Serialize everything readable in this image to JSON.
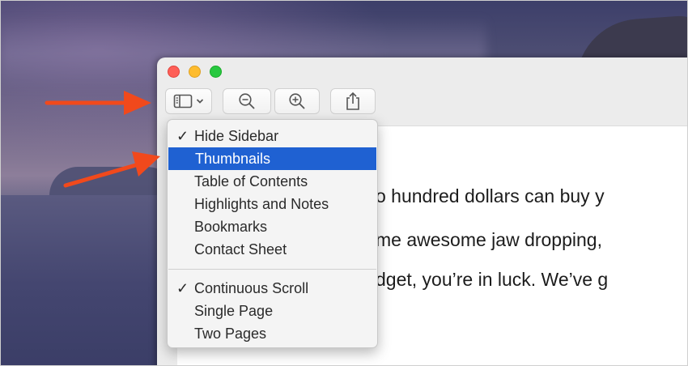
{
  "colors": {
    "menu_highlight": "#1f61d2",
    "arrow": "#f1491c",
    "close": "#fe5f57",
    "minimize": "#febc2e",
    "zoom": "#28c840"
  },
  "toolbar": {
    "sidebar_button_icon": "sidebar-icon",
    "sidebar_chevron_icon": "chevron-down-icon",
    "zoom_out_icon": "zoom-out-icon",
    "zoom_in_icon": "zoom-in-icon",
    "share_icon": "share-icon"
  },
  "menu": {
    "group1": [
      {
        "label": "Hide Sidebar",
        "checked": true,
        "selected": false
      },
      {
        "label": "Thumbnails",
        "checked": false,
        "selected": true
      },
      {
        "label": "Table of Contents",
        "checked": false,
        "selected": false
      },
      {
        "label": "Highlights and Notes",
        "checked": false,
        "selected": false
      },
      {
        "label": "Bookmarks",
        "checked": false,
        "selected": false
      },
      {
        "label": "Contact Sheet",
        "checked": false,
        "selected": false
      }
    ],
    "group2": [
      {
        "label": "Continuous Scroll",
        "checked": true,
        "selected": false
      },
      {
        "label": "Single Page",
        "checked": false,
        "selected": false
      },
      {
        "label": "Two Pages",
        "checked": false,
        "selected": false
      }
    ],
    "check_mark": "✓"
  },
  "document": {
    "lines": [
      "o hundred dollars can buy y",
      "me awesome jaw dropping,",
      "dget, you’re in luck. We’ve g"
    ]
  }
}
